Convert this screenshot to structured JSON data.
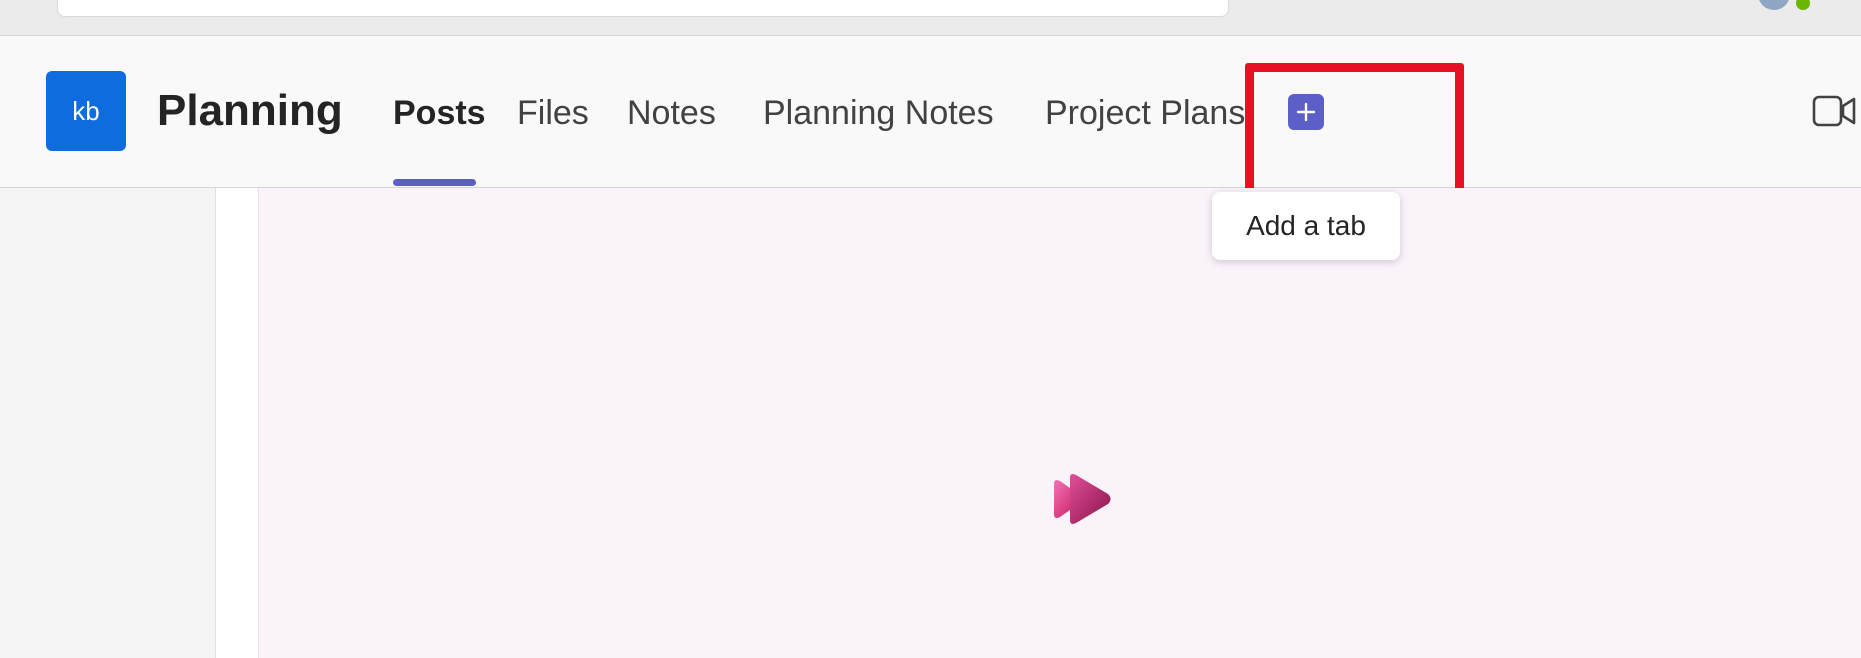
{
  "team": {
    "avatar_initials": "kb",
    "avatar_color": "#0f6cde",
    "channel_name": "Planning"
  },
  "tabs": [
    {
      "label": "Posts",
      "active": true
    },
    {
      "label": "Files",
      "active": false
    },
    {
      "label": "Notes",
      "active": false
    },
    {
      "label": "Planning Notes",
      "active": false
    },
    {
      "label": "Project Plans",
      "active": false
    }
  ],
  "add_tab": {
    "icon": "plus-icon",
    "tooltip": "Add a tab",
    "accent_color": "#5b5fc7",
    "highlight_color": "#e81123"
  },
  "header_actions": {
    "meet_icon": "video-camera-icon"
  },
  "content": {
    "loading_icon": "stream-app-logo-icon",
    "background_color": "#fbf3fa"
  }
}
